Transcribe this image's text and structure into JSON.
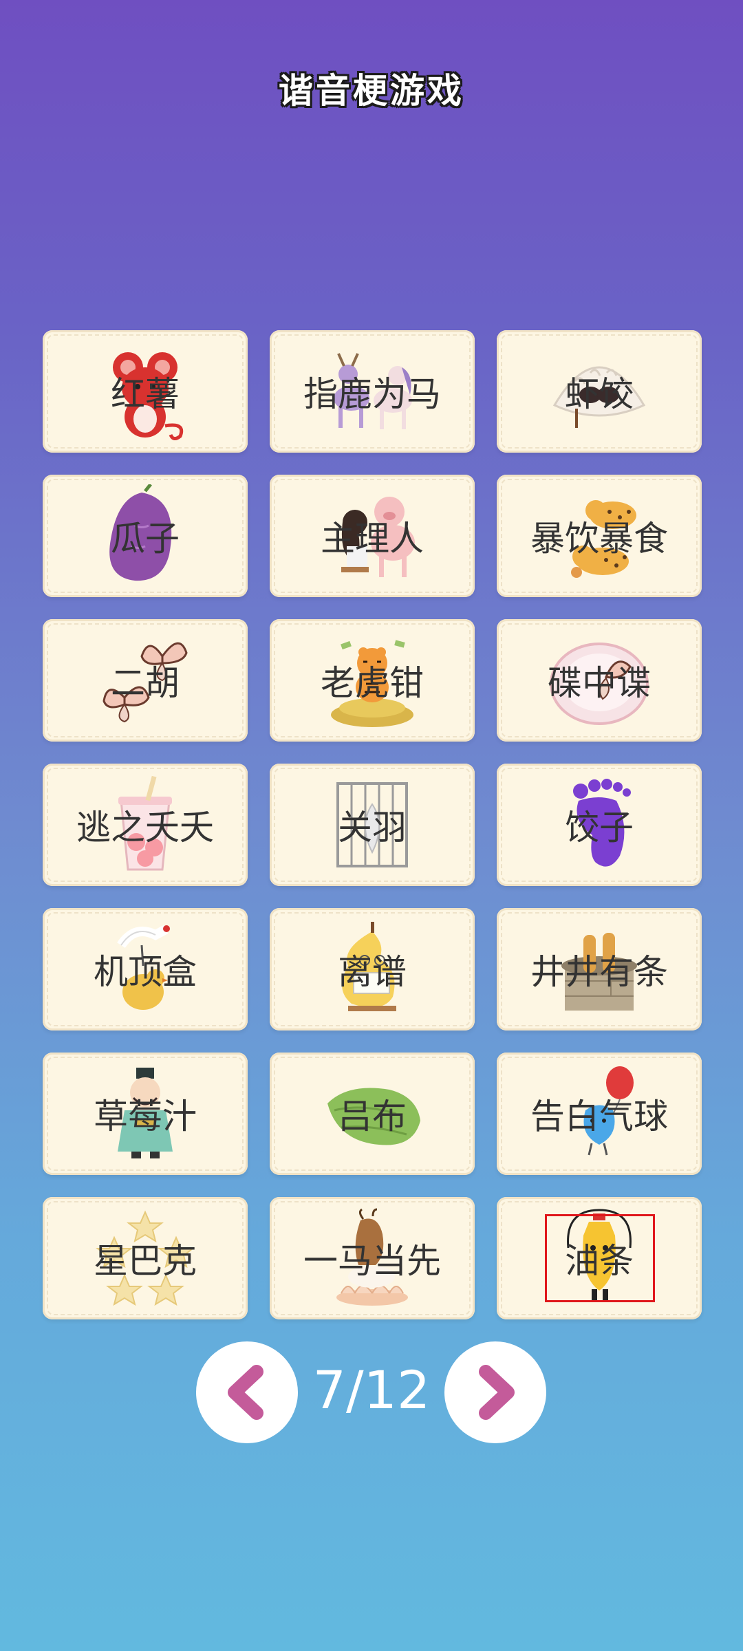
{
  "title": "谐音梗游戏",
  "cards": [
    {
      "label": "红薯",
      "icon": "red-mouse-icon"
    },
    {
      "label": "指鹿为马",
      "icon": "deer-and-horse-icon"
    },
    {
      "label": "虾饺",
      "icon": "dumpling-icon"
    },
    {
      "label": "瓜子",
      "icon": "purple-sweet-potato-icon"
    },
    {
      "label": "主理人",
      "icon": "girl-and-pig-icon"
    },
    {
      "label": "暴饮暴食",
      "icon": "leopards-icon"
    },
    {
      "label": "二胡",
      "icon": "butterflies-icon"
    },
    {
      "label": "老虎钳",
      "icon": "tiger-on-coins-icon"
    },
    {
      "label": "碟中谍",
      "icon": "butterfly-on-plate-icon"
    },
    {
      "label": "逃之夭夭",
      "icon": "peach-drink-icon"
    },
    {
      "label": "关羽",
      "icon": "feather-in-cage-icon"
    },
    {
      "label": "饺子",
      "icon": "purple-foot-icon"
    },
    {
      "label": "机顶盒",
      "icon": "crane-on-chicken-icon"
    },
    {
      "label": "离谱",
      "icon": "pear-reading-icon"
    },
    {
      "label": "井井有条",
      "icon": "fried-dough-in-well-icon"
    },
    {
      "label": "草莓汁",
      "icon": "ancient-man-icon"
    },
    {
      "label": "吕布",
      "icon": "green-towel-icon"
    },
    {
      "label": "告白气球",
      "icon": "balloon-character-icon"
    },
    {
      "label": "星巴克",
      "icon": "star-cookies-icon"
    },
    {
      "label": "一马当先",
      "icon": "horse-on-lotus-icon"
    },
    {
      "label": "油条",
      "icon": "oil-bottle-jump-rope-icon"
    }
  ],
  "selected_index": 20,
  "pager": {
    "text": "7/12",
    "prev_icon": "chevron-left-icon",
    "next_icon": "chevron-right-icon"
  },
  "colors": {
    "card_bg": "#fdf6e3",
    "label": "#333333",
    "chevron": "#c45b9a",
    "highlight": "#e0171b"
  }
}
